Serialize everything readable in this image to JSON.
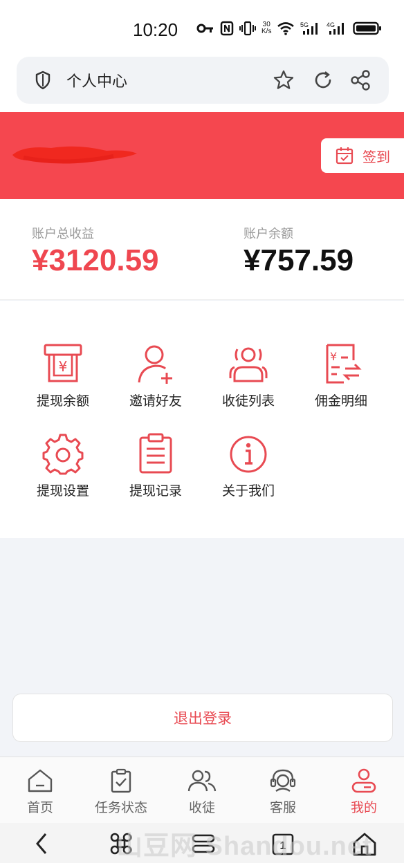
{
  "status_bar": {
    "time": "10:20",
    "speed_top": "30",
    "speed_bottom": "K/s",
    "net_5g": "5G",
    "net_4g": "4G"
  },
  "browser": {
    "page_title": "个人中心"
  },
  "header": {
    "background_color": "#f5474f",
    "checkin_label": "签到"
  },
  "account": {
    "total_earnings_label": "账户总收益",
    "total_earnings_value": "¥3120.59",
    "balance_label": "账户余额",
    "balance_value": "¥757.59"
  },
  "menu": {
    "items": [
      {
        "label": "提现余额",
        "icon": "withdraw-balance-icon"
      },
      {
        "label": "邀请好友",
        "icon": "invite-friend-icon"
      },
      {
        "label": "收徒列表",
        "icon": "apprentice-list-icon"
      },
      {
        "label": "佣金明细",
        "icon": "commission-detail-icon"
      },
      {
        "label": "提现设置",
        "icon": "gear-icon"
      },
      {
        "label": "提现记录",
        "icon": "clipboard-icon"
      },
      {
        "label": "关于我们",
        "icon": "info-icon"
      }
    ]
  },
  "logout_label": "退出登录",
  "tabbar": {
    "items": [
      {
        "label": "首页",
        "icon": "home-icon"
      },
      {
        "label": "任务状态",
        "icon": "task-clipboard-icon"
      },
      {
        "label": "收徒",
        "icon": "users-icon"
      },
      {
        "label": "客服",
        "icon": "headset-icon"
      },
      {
        "label": "我的",
        "icon": "profile-icon",
        "active": true
      }
    ],
    "active_color": "#e84a52"
  },
  "watermark": "山豆网 Shandou.net",
  "accent_color": "#e84a52"
}
